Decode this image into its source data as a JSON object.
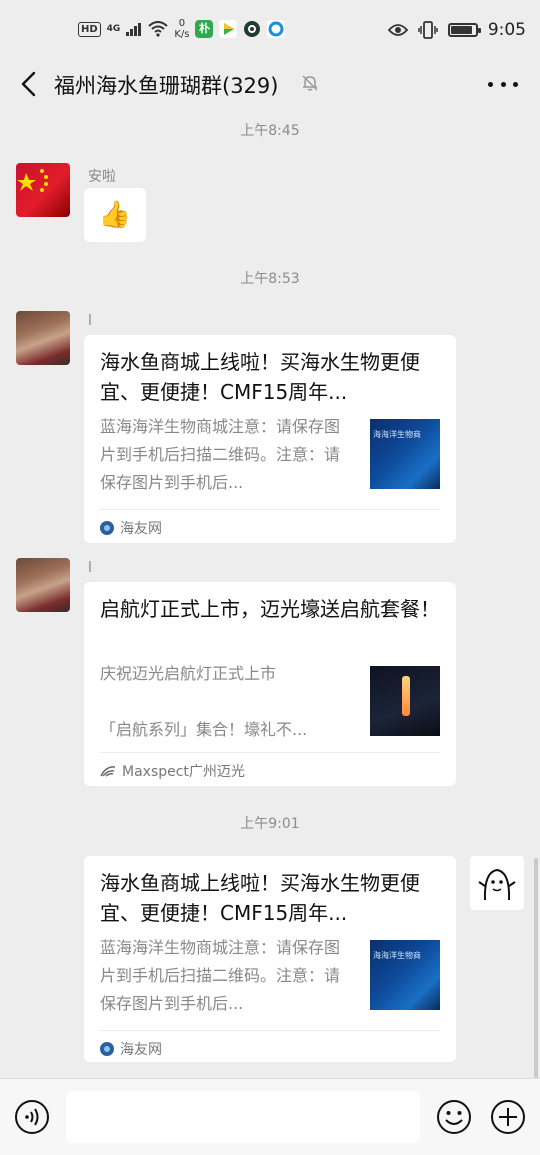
{
  "status_bar": {
    "hd": "HD",
    "network": "4G",
    "speed_value": "0",
    "speed_unit": "K/s",
    "app_badge_1": "朴",
    "time": "9:05"
  },
  "header": {
    "title": "福州海水鱼珊瑚群(329)"
  },
  "messages": [
    {
      "timestamp": "上午8:45",
      "sender": "安啦",
      "content": "👍"
    },
    {
      "timestamp": "上午8:53",
      "sender": "l",
      "card": {
        "title": "海水鱼商城上线啦！买海水生物更便宜、更便捷！CMF15周年...",
        "desc": "蓝海海洋生物商城注意：请保存图片到手机后扫描二维码。注意：请保存图片到手机后...",
        "source": "海友网"
      }
    },
    {
      "sender": "l",
      "card": {
        "title": "启航灯正式上市，迈光壕送启航套餐！",
        "desc": "庆祝迈光启航灯正式上市\n\n「启航系列」集合！壕礼不...",
        "source": "Maxspect广州迈光"
      }
    },
    {
      "timestamp": "上午9:01",
      "card": {
        "title": "海水鱼商城上线啦！买海水生物更便宜、更便捷！CMF15周年...",
        "desc": "蓝海海洋生物商城注意：请保存图片到手机后扫描二维码。注意：请保存图片到手机后...",
        "source": "海友网"
      }
    }
  ],
  "card_image_text": "海海洋生物商",
  "colors": {
    "background": "#ededed",
    "bubble": "#ffffff",
    "muted_text": "#888888",
    "input_bar": "#f7f7f7"
  }
}
